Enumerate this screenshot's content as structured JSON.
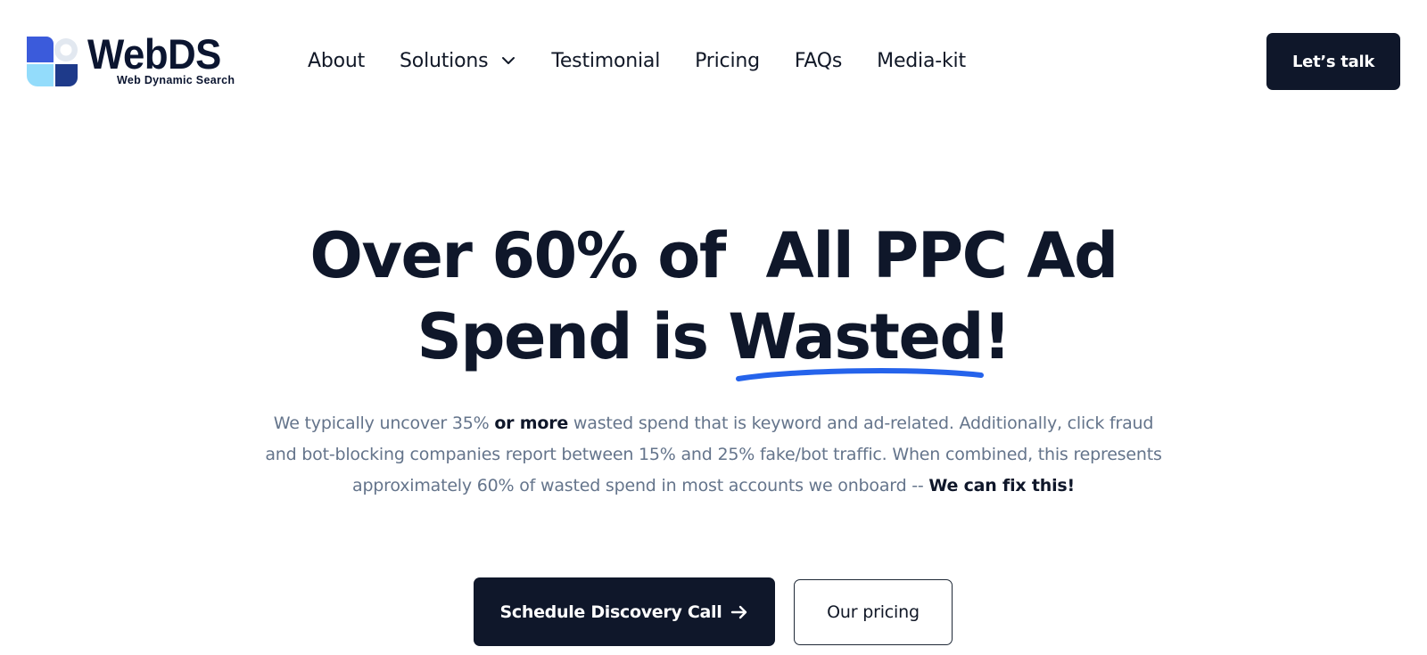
{
  "brand": {
    "name": "WebDS",
    "tagline": "Web Dynamic Search",
    "colors": {
      "dark_blue": "#1e3a8a",
      "mid_blue": "#3b5bdb",
      "light_blue": "#93dcfb",
      "pale_blue": "#e2e8f0"
    }
  },
  "nav": {
    "items": [
      {
        "label": "About"
      },
      {
        "label": "Solutions",
        "icon": "chevron-down-icon"
      },
      {
        "label": "Testimonial"
      },
      {
        "label": "Pricing"
      },
      {
        "label": "FAQs"
      },
      {
        "label": "Media-kit"
      }
    ],
    "cta_label": "Let’s talk"
  },
  "hero": {
    "title_line1": "Over 60% of  All PPC Ad",
    "title_line2_prefix": "Spend is ",
    "title_highlight": "Wasted",
    "title_suffix": "!",
    "underline_color": "#2563eb",
    "desc_part1": "We typically uncover 35% ",
    "desc_bold1": "or more",
    "desc_part2": " wasted spend that is keyword and ad-related. Additionally, click fraud and bot-blocking companies report between 15% and 25% fake/bot traffic. When combined, this represents approximately 60% of wasted spend in most accounts we onboard -- ",
    "desc_bold2": "We can fix this!"
  },
  "actions": {
    "primary_label": "Schedule Discovery Call",
    "primary_icon": "arrow-right-icon",
    "secondary_label": "Our pricing"
  }
}
